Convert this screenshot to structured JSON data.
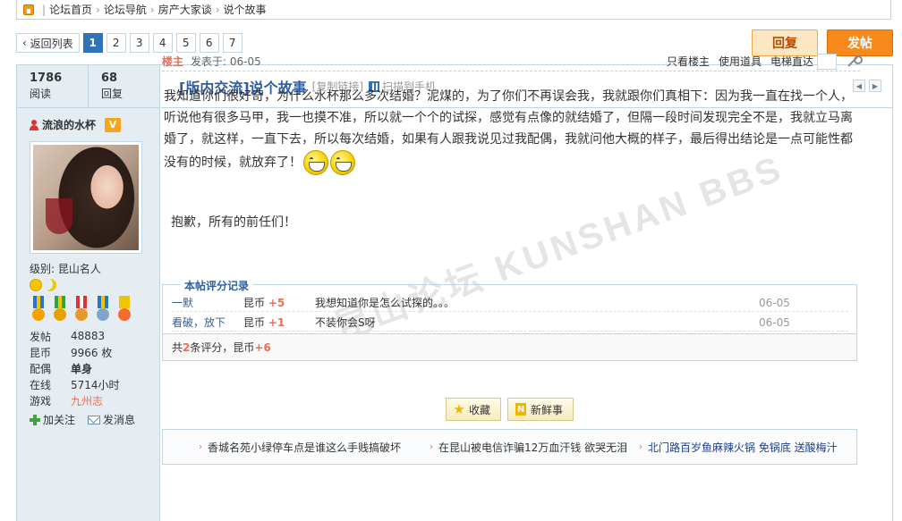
{
  "breadcrumb": [
    "论坛首页",
    "论坛导航",
    "房产大家谈",
    "说个故事"
  ],
  "pager": {
    "back": "返回列表",
    "pages": [
      "1",
      "2",
      "3",
      "4",
      "5",
      "6",
      "7"
    ],
    "current": "1"
  },
  "actions": {
    "reply": "回复",
    "post": "发帖"
  },
  "stats": {
    "views": "1786",
    "views_label": "阅读",
    "replies": "68",
    "replies_label": "回复"
  },
  "thread": {
    "title": "[版内交流]说个故事",
    "copy_link": "[复制链接]",
    "scan": "扫描到手机"
  },
  "user": {
    "name": "流浪的水杯",
    "vip": "V",
    "level": "级别: 昆山名人",
    "info": [
      {
        "k": "发帖",
        "v": "48883"
      },
      {
        "k": "昆币",
        "v": "9966 枚"
      },
      {
        "k": "配偶",
        "v": "单身"
      },
      {
        "k": "在线",
        "v": "5714小时"
      },
      {
        "k": "游戏",
        "v": "九州志"
      }
    ],
    "follow": "加关注",
    "message": "发消息"
  },
  "post": {
    "floor": "楼主",
    "date": "发表于: 06-05",
    "only_owner": "只看楼主",
    "tools": "使用道具",
    "elevator": "电梯直达",
    "body": "我知道你们很好奇，为什么水杯那么多次结婚？泥煤的，为了你们不再误会我，我就跟你们真相下：因为我一直在找一个人，听说他有很多马甲，我一也摸不准，所以就一个个的试探，感觉有点像的就结婚了，但隔一段时间发现完全不是，我就立马离婚了，就这样，一直下去，所以每次结婚，如果有人跟我说见过我配偶，我就问他大概的样子，最后得出结论是一点可能性都没有的时候，就放弃了！",
    "body2": "抱歉，所有的前任们！",
    "watermark": "昆山论坛 KUNSHAN BBS"
  },
  "rating": {
    "legend": "本帖评分记录",
    "rows": [
      {
        "user": "一默",
        "currency": "昆币",
        "amount": "+5",
        "comment": "我想知道你是怎么试探的。。。",
        "date": "06-05"
      },
      {
        "user": "看破，放下",
        "currency": "昆币",
        "amount": "+1",
        "comment": "不装你会S呀",
        "date": "06-05"
      }
    ],
    "summary_pre": "共",
    "summary_count": "2",
    "summary_mid": "条评分，昆币",
    "summary_total": "+6"
  },
  "buttons": {
    "favorite": "收藏",
    "fresh": "新鲜事"
  },
  "related": [
    "香城名苑小绿停车点是谁这么手贱搞破坏",
    "在昆山被电信诈骗12万血汗钱 欲哭无泪",
    "北门路百岁鱼麻辣火锅 免锅底 送酸梅汁"
  ],
  "colors": {
    "accent": "#2f73b8",
    "orange": "#f7891b",
    "highlight": "#f26c4f"
  }
}
